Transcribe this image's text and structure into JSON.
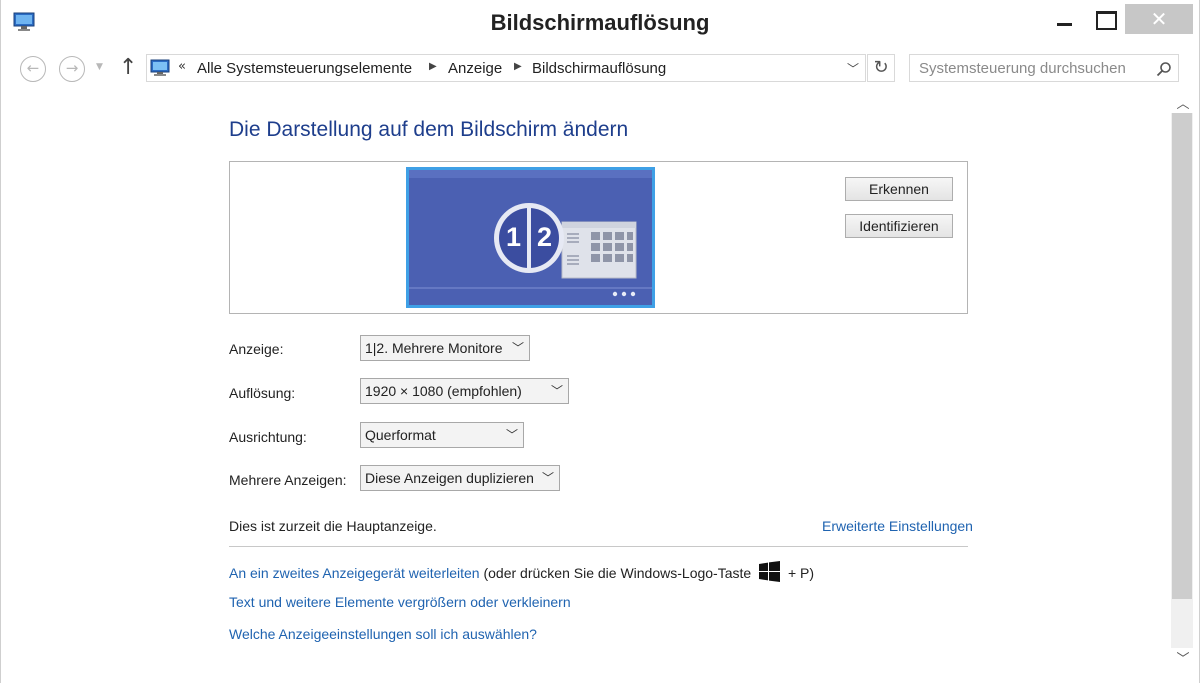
{
  "window": {
    "title": "Bildschirmauflösung",
    "close_glyph": "✕"
  },
  "nav": {
    "back_glyph": "←",
    "forward_glyph": "→",
    "up_glyph": "↑",
    "refresh_glyph": "↻",
    "breadcrumb_prefix": "«",
    "breadcrumbs": [
      "Alle Systemsteuerungselemente",
      "Anzeige",
      "Bildschirmauflösung"
    ],
    "search_placeholder": "Systemsteuerung durchsuchen"
  },
  "main": {
    "heading": "Die Darstellung auf dem Bildschirm ändern",
    "monitor_badge_left": "1",
    "monitor_badge_right": "2",
    "detect_label": "Erkennen",
    "identify_label": "Identifizieren",
    "fields": [
      {
        "label": "Anzeige:",
        "value": "1|2. Mehrere Monitore"
      },
      {
        "label": "Auflösung:",
        "value": "1920 × 1080 (empfohlen)"
      },
      {
        "label": "Ausrichtung:",
        "value": "Querformat"
      },
      {
        "label": "Mehrere Anzeigen:",
        "value": "Diese Anzeigen duplizieren"
      }
    ],
    "primary_hint": "Dies ist zurzeit die Hauptanzeige.",
    "advanced_link": "Erweiterte Einstellungen",
    "project_link": "An ein zweites Anzeigegerät weiterleiten",
    "project_suffix_before": "(oder drücken Sie die Windows-Logo-Taste",
    "project_suffix_after": "+ P)",
    "text_size_link": "Text und weitere Elemente vergrößern oder verkleinern",
    "which_settings_link": "Welche Anzeigeeinstellungen soll ich auswählen?"
  },
  "colors": {
    "heading": "#1e3e8c",
    "link": "#1f63b0",
    "monitor_fill": "#4a5fb0",
    "monitor_border": "#3fa0e6"
  },
  "icons": {
    "app": "monitor-icon",
    "search": "magnifier-icon",
    "windows": "windows-logo-icon"
  }
}
